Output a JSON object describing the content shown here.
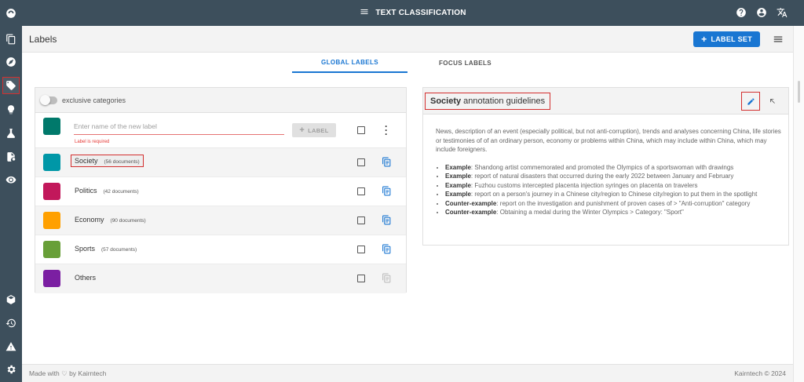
{
  "topbar": {
    "title": "TEXT CLASSIFICATION"
  },
  "page": {
    "title": "Labels",
    "label_set_button": "LABEL SET"
  },
  "tabs": [
    {
      "label": "GLOBAL LABELS",
      "active": true
    },
    {
      "label": "FOCUS LABELS",
      "active": false
    }
  ],
  "labels_panel": {
    "toggle_label": "exclusive categories",
    "new_label": {
      "placeholder": "Enter name of the new label",
      "error": "Label is required",
      "add_button": "LABEL",
      "color": "#00796b"
    },
    "items": [
      {
        "name": "Society",
        "count": "(56 documents)",
        "color": "#0097a7"
      },
      {
        "name": "Politics",
        "count": "(42 documents)",
        "color": "#c2185b"
      },
      {
        "name": "Economy",
        "count": "(90 documents)",
        "color": "#ffa000"
      },
      {
        "name": "Sports",
        "count": "(57 documents)",
        "color": "#689f38"
      },
      {
        "name": "Others",
        "count": "",
        "color": "#7b1fa2"
      }
    ]
  },
  "guidelines": {
    "title_bold": "Society",
    "title_rest": "annotation guidelines",
    "intro": "News, description of an event (especially political, but not anti-corruption), trends and analyses concerning China, life stories or testimonies of of an ordinary person, economy or problems within China, which may include within China, which may include foreigners.",
    "bullets": [
      {
        "kind": "Example",
        "text": ": Shandong artist commemorated and promoted the Olympics of a sportswoman with drawings"
      },
      {
        "kind": "Example",
        "text": ": report of natural disasters that occurred during the early 2022 between January and February"
      },
      {
        "kind": "Example",
        "text": ": Fuzhou customs intercepted placenta injection syringes on placenta on travelers"
      },
      {
        "kind": "Example",
        "text": ": report on a person's journey in a Chinese city/region to Chinese city/region to put them in the spotlight"
      },
      {
        "kind": "Counter-example",
        "text": ": report on the investigation and punishment of proven cases of > \"Anti-corruption\" category"
      },
      {
        "kind": "Counter-example",
        "text": ": Obtaining a medal during the Winter Olympics > Category: \"Sport\""
      }
    ]
  },
  "footer": {
    "left": "Made with ♡ by Kairntech",
    "right": "Kairntech © 2024"
  },
  "colors": {
    "accent": "#1976d2",
    "nav_bg": "#3d4f5c",
    "highlight": "#d32f2f",
    "error": "#e53935"
  }
}
